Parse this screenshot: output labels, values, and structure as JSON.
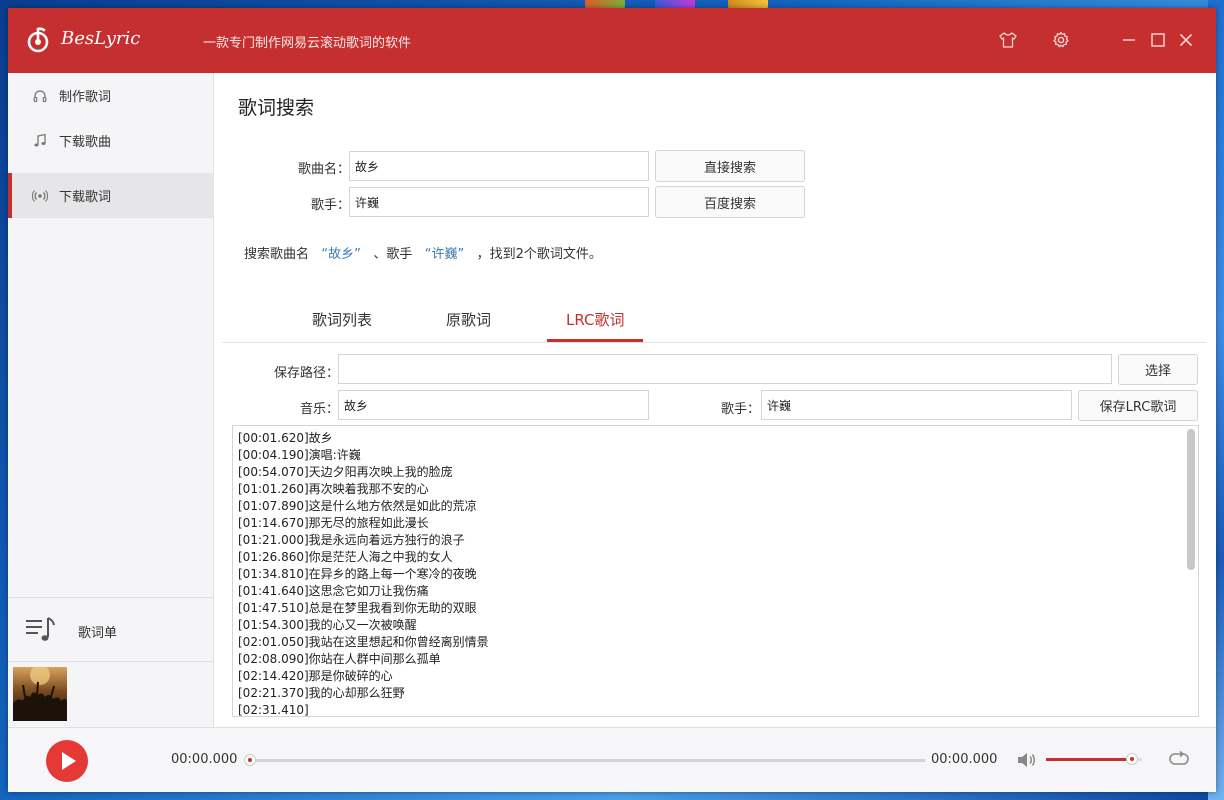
{
  "app": {
    "name": "BesLyric",
    "slogan": "一款专门制作网易云滚动歌词的软件",
    "accent_color": "#c62f2f"
  },
  "titlebar": {
    "buttons": [
      "skin-icon",
      "settings-icon",
      "minimize-icon",
      "maximize-icon",
      "close-icon"
    ]
  },
  "sidebar": {
    "items": [
      {
        "label": "制作歌词",
        "icon": "headphones-icon",
        "active": false
      },
      {
        "label": "下载歌曲",
        "icon": "music-note-icon",
        "active": false
      },
      {
        "label": "下载歌词",
        "icon": "radio-icon",
        "active": true
      }
    ],
    "playlist_label": "歌词单"
  },
  "search": {
    "heading": "歌词搜索",
    "song_label": "歌曲名：",
    "song_value": "故乡",
    "artist_label": "歌手：",
    "artist_value": "许巍",
    "direct_search_button": "直接搜索",
    "baidu_search_button": "百度搜索",
    "result_prefix": "搜索歌曲名",
    "result_song": "“故乡”",
    "result_mid": "、歌手",
    "result_artist": "“许巍”",
    "result_suffix": "，找到2个歌词文件。"
  },
  "tabs": [
    {
      "label": "歌词列表",
      "active": false
    },
    {
      "label": "原歌词",
      "active": false
    },
    {
      "label": "LRC歌词",
      "active": true
    }
  ],
  "lrc": {
    "save_path_label": "保存路径：",
    "save_path_value": "",
    "choose_button": "选择",
    "music_label": "音乐：",
    "music_value": "故乡",
    "artist_label": "歌手：",
    "artist_value": "许巍",
    "save_button": "保存LRC歌词",
    "lyrics": "[00:01.620]故乡\n[00:04.190]演唱:许巍\n[00:54.070]天边夕阳再次映上我的脸庞\n[01:01.260]再次映着我那不安的心\n[01:07.890]这是什么地方依然是如此的荒凉\n[01:14.670]那无尽的旅程如此漫长\n[01:21.000]我是永远向着远方独行的浪子\n[01:26.860]你是茫茫人海之中我的女人\n[01:34.810]在异乡的路上每一个寒冷的夜晚\n[01:41.640]这思念它如刀让我伤痛\n[01:47.510]总是在梦里我看到你无助的双眼\n[01:54.300]我的心又一次被唤醒\n[02:01.050]我站在这里想起和你曾经离别情景\n[02:08.090]你站在人群中间那么孤单\n[02:14.420]那是你破碎的心\n[02:21.370]我的心却那么狂野\n[02:31.410]"
  },
  "player": {
    "current_time": "00:00.000",
    "total_time": "00:00.000",
    "progress_fraction": 0.0,
    "volume_fraction": 0.95
  }
}
